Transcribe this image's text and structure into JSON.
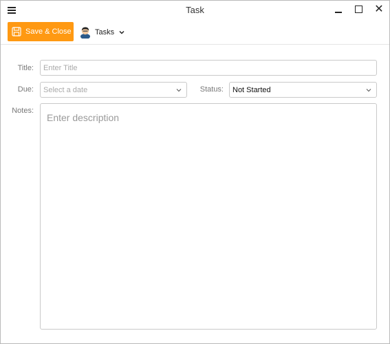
{
  "window": {
    "title": "Task"
  },
  "toolbar": {
    "save_label": "Save & Close",
    "folder_label": "Tasks",
    "accent": "#ff9912"
  },
  "form": {
    "title_label": "Title:",
    "title_placeholder": "Enter Title",
    "due_label": "Due:",
    "due_placeholder": "Select a date",
    "status_label": "Status:",
    "status_value": "Not Started",
    "notes_label": "Notes:",
    "notes_placeholder": "Enter description"
  },
  "icons": [
    "menu-icon",
    "minimize-icon",
    "maximize-icon",
    "close-icon",
    "save-icon",
    "avatar-icon",
    "chevron-down-icon"
  ]
}
